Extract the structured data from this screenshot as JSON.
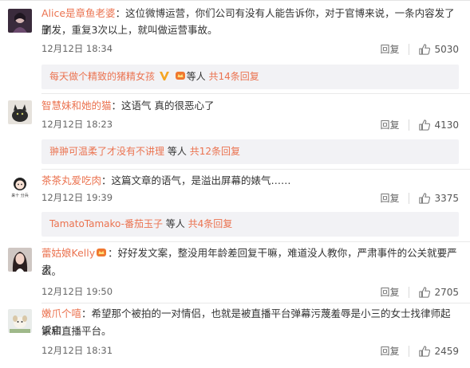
{
  "comments": [
    {
      "username": "Alice是章鱼老婆",
      "text_1": "：这位微博运营，你们公司有没有人能告诉你，对于官博来说，一条内容发了删",
      "text_2": "了发，重复3次以上，就叫做运营事故。",
      "time": "12月12日 18:34",
      "reply_label": "回复",
      "likes": "5030",
      "thread_user": "每天做个精致的猪精女孩",
      "thread_deng": "等人",
      "thread_total": "共14条回复",
      "avatar_icon": "avatar-girl-dark-icon"
    },
    {
      "username": "智慧妹和她的猫",
      "text_1": "：这语气 真的很恶心了",
      "time": "12月12日 18:23",
      "reply_label": "回复",
      "likes": "4130",
      "thread_user": "翀翀可温柔了才没有不讲理",
      "thread_deng": "等人",
      "thread_total": "共12条回复",
      "avatar_icon": "avatar-cat-icon"
    },
    {
      "username": "茶茶丸爱吃肉",
      "text_1": "：这篇文章的语气，是溢出屏幕的婊气……",
      "time": "12月12日 19:39",
      "reply_label": "回复",
      "likes": "3375",
      "thread_user": "TamatoTamako-番茄玉子",
      "thread_deng": "等人",
      "thread_total": "共4条回复",
      "avatar_icon": "avatar-cartoon-icon",
      "avatar_caption": "来十 分兵"
    },
    {
      "username": "蕾姑娘Kelly",
      "text_1": "：好好发文案，整没用年龄差回复干嘛，难道没人教你，严肃事件的公关就要严肃",
      "text_2": "么。",
      "time": "12月12日 19:50",
      "reply_label": "回复",
      "likes": "2705",
      "avatar_icon": "avatar-woman-icon"
    },
    {
      "username": "嫩爪个嘻",
      "text_1": "：希望那个被拍的一对情侣，也就是被直播平台弹幕污蔑羞辱是小三的女士找律师起诉店",
      "text_2": "家和直播平台。",
      "time": "12月12日 18:31",
      "reply_label": "回复",
      "likes": "2459",
      "avatar_icon": "avatar-puppy-icon"
    }
  ],
  "colors": {
    "username": "#eb7350",
    "text": "#333333",
    "meta": "#666666",
    "reply_box_bg": "#f2f2f5",
    "badge": "#f5a623"
  },
  "icons": {
    "like": "thumbs-up-icon",
    "vip": "vip-v-icon",
    "member": "member-crown-icon"
  }
}
